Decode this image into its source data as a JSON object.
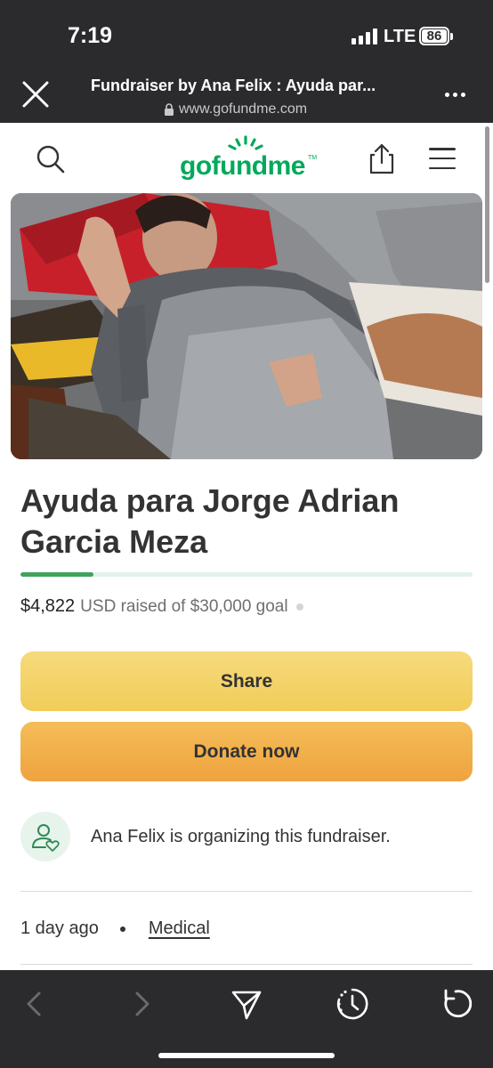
{
  "status_bar": {
    "time": "7:19",
    "network": "LTE",
    "battery": "86"
  },
  "browser": {
    "page_title": "Fundraiser by Ana Felix : Ayuda par...",
    "url": "www.gofundme.com"
  },
  "site": {
    "logo_text": "gofundme",
    "logo_tm": "TM",
    "brand_color": "#02a95c"
  },
  "hero": {
    "image_icon": "photo-image"
  },
  "fundraiser": {
    "title": "Ayuda para Jorge Adrian Garcia Meza",
    "raised_amount": "$4,822",
    "raised_rest": "USD raised of $30,000 goal",
    "progress_fraction": 0.161,
    "share_label": "Share",
    "donate_label": "Donate now",
    "organizer_text": "Ana Felix is organizing this fundraiser.",
    "posted": "1 day ago",
    "category": "Medical"
  },
  "icons": {
    "close": "close-icon",
    "lock": "lock-icon",
    "more": "more-icon",
    "search": "search-icon",
    "share": "share-icon",
    "menu": "menu-icon",
    "organizer": "user-heart-icon",
    "back": "chevron-left-icon",
    "forward": "chevron-right-icon",
    "send": "send-icon",
    "timer": "timer-icon",
    "reload": "reload-icon"
  }
}
